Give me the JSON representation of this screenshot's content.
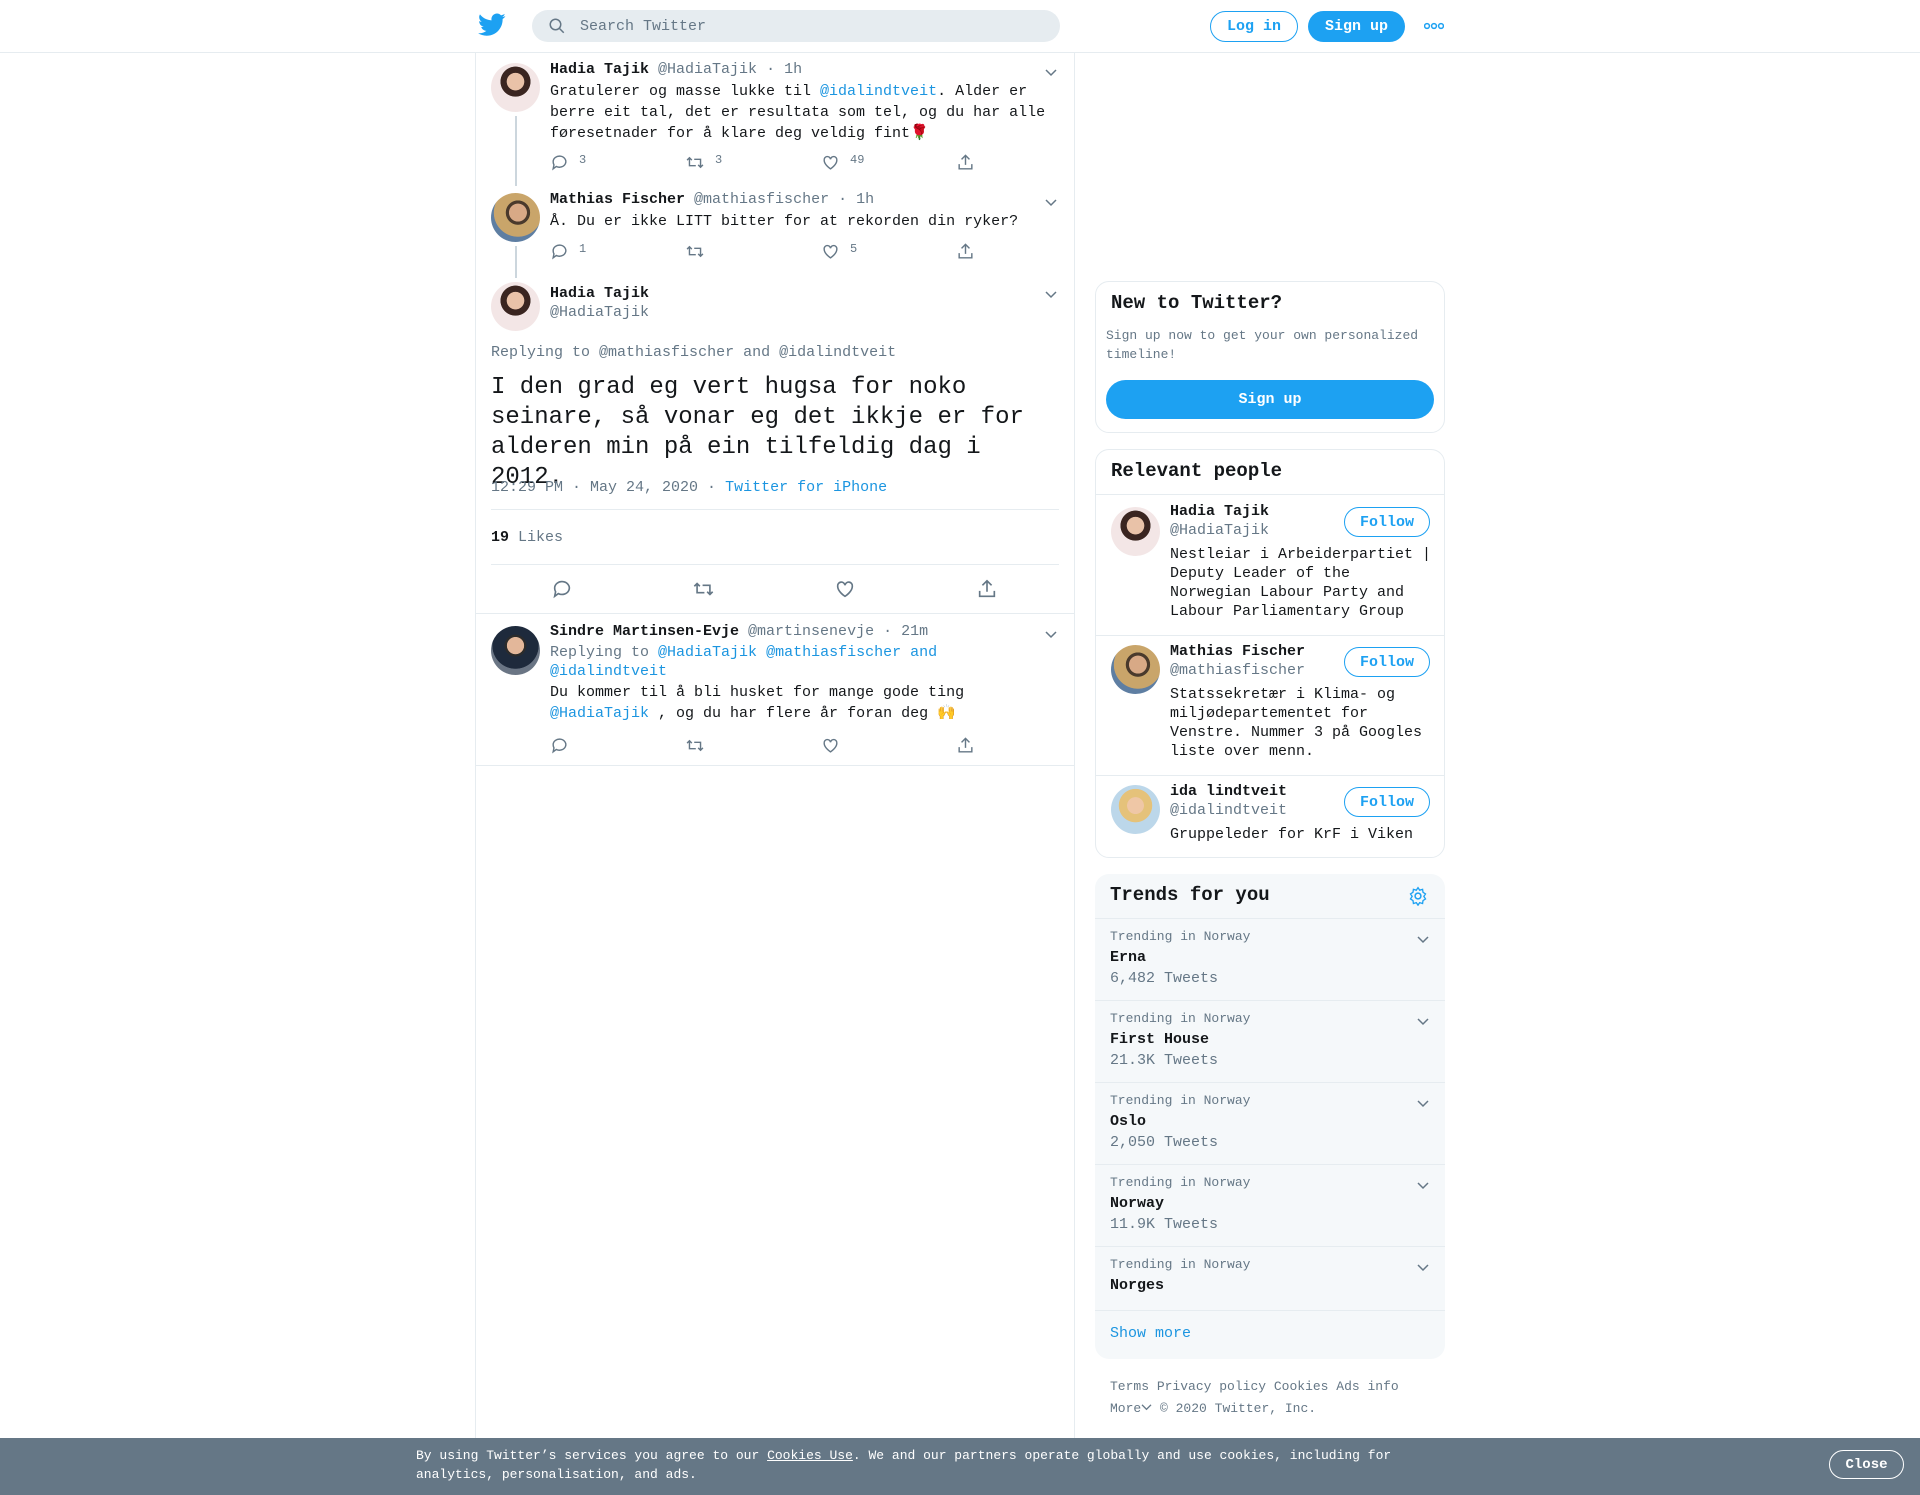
{
  "header": {
    "search_placeholder": "Search Twitter",
    "login_label": "Log in",
    "signup_label": "Sign up"
  },
  "thread": [
    {
      "name": "Hadia Tajik",
      "handle": "@HadiaTajik",
      "time": "· 1h",
      "text_before": "Gratulerer og masse lukke til ",
      "mention": "@idalindtveit",
      "text_after": ". Alder er berre eit tal, det er resultata som tel, og du har alle føresetnader for å klare deg veldig fint🌹",
      "replies": "3",
      "retweets": "3",
      "likes": "49"
    },
    {
      "name": "Mathias Fischer",
      "handle": "@mathiasfischer",
      "time": "· 1h",
      "text": "Å. Du er ikke LITT bitter for at rekorden din ryker?",
      "replies": "1",
      "retweets": "",
      "likes": "5"
    }
  ],
  "main_tweet": {
    "name": "Hadia Tajik",
    "handle": "@HadiaTajik",
    "replying_label": "Replying to",
    "replying_to": "@mathiasfischer and @idalindtveit",
    "text": "I den grad eg vert hugsa for noko seinare, så vonar eg det ikkje er for alderen min på ein tilfeldig dag i 2012.",
    "time": "12:29 PM · May 24, 2020 ·",
    "source": "Twitter for iPhone",
    "likes_count": "19",
    "likes_label": "Likes"
  },
  "reply": {
    "name": "Sindre Martinsen-Evje",
    "handle": "@martinsenevje",
    "time": "· 21m",
    "replying_label": "Replying to",
    "replying_to": "@HadiaTajik @mathiasfischer and @idalindtveit",
    "text_before": "Du kommer til å bli husket for mange gode ting ",
    "mention": "@HadiaTajik",
    "text_after": " , og du har flere år foran deg 🙌"
  },
  "new_to_twitter": {
    "title": "New to Twitter?",
    "subtitle": "Sign up now to get your own personalized timeline!",
    "button": "Sign up"
  },
  "relevant_people": {
    "title": "Relevant people",
    "follow_label": "Follow",
    "people": [
      {
        "name": "Hadia Tajik",
        "handle": "@HadiaTajik",
        "bio": "Nestleiar i Arbeiderpartiet | Deputy Leader of the Norwegian Labour Party and Labour Parliamentary Group"
      },
      {
        "name": "Mathias Fischer",
        "handle": "@mathiasfischer",
        "bio": "Statssekretær i Klima- og miljødepartementet for Venstre. Nummer 3 på Googles liste over menn."
      },
      {
        "name": "ida lindtveit",
        "handle": "@idalindtveit",
        "bio": "Gruppeleder for KrF i Viken"
      }
    ]
  },
  "trends": {
    "title": "Trends for you",
    "items": [
      {
        "meta": "Trending in Norway",
        "name": "Erna",
        "count": "6,482 Tweets"
      },
      {
        "meta": "Trending in Norway",
        "name": "First House",
        "count": "21.3K Tweets"
      },
      {
        "meta": "Trending in Norway",
        "name": "Oslo",
        "count": "2,050 Tweets"
      },
      {
        "meta": "Trending in Norway",
        "name": "Norway",
        "count": "11.9K Tweets"
      },
      {
        "meta": "Trending in Norway",
        "name": "Norges",
        "count": ""
      }
    ],
    "show_more": "Show more"
  },
  "footer": {
    "terms": "Terms",
    "privacy": "Privacy policy",
    "cookies": "Cookies",
    "ads": "Ads info",
    "more": "More",
    "copyright": "© 2020 Twitter, Inc."
  },
  "cookie_banner": {
    "text_before": "By using Twitter’s services you agree to our ",
    "link": "Cookies Use",
    "text_after": ". We and our partners operate globally and use cookies, including for analytics, personalisation, and ads.",
    "close": "Close"
  },
  "colors": {
    "accent": "#1da1f2",
    "link": "#1b95e0",
    "muted": "#657786",
    "banner": "#657786"
  }
}
